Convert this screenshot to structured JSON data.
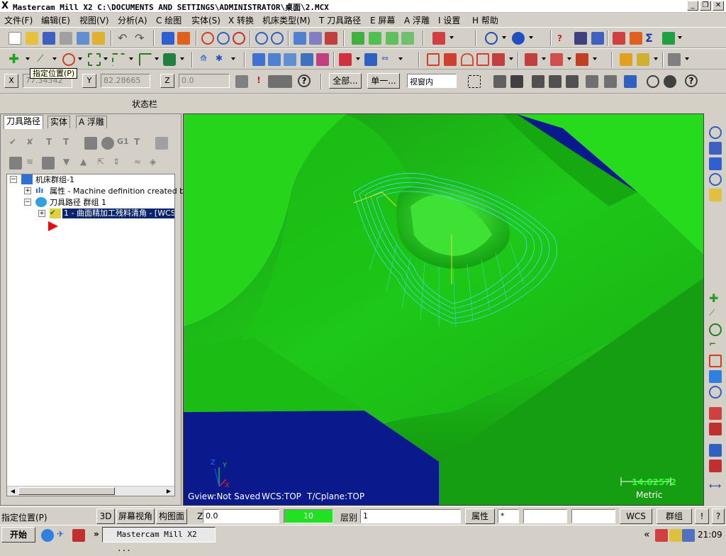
{
  "window": {
    "title": "Mastercam Mill  X2  C:\\DOCUMENTS AND SETTINGS\\ADMINISTRATOR\\桌面\\2.MCX",
    "icon": "mastercam-x-icon"
  },
  "menu": [
    "文件(F)",
    "编辑(E)",
    "视图(V)",
    "分析(A)",
    "C 绘图",
    "实体(S)",
    "X 转换",
    "机床类型(M)",
    "T 刀具路径",
    "E 屏幕",
    "A 浮雕",
    "I 设置",
    "H 帮助"
  ],
  "tooltip": "指定位置(P)",
  "autocursor": {
    "x_label": "X",
    "x_value": "77.34342",
    "y_label": "Y",
    "y_value": "82.28665",
    "z_label": "Z",
    "z_value": "0.0",
    "all_button": "全部...",
    "single_button": "单一...",
    "window_select": "视窗内"
  },
  "status_label": "状态栏",
  "left_panel": {
    "tabs": [
      "刀具路径",
      "实体",
      "A 浮雕"
    ],
    "tree": {
      "root": "机床群组-1",
      "properties": "属性 - Machine definition created by",
      "group": "刀具路径 群组 1",
      "operation": "1 - 曲面精加工残料清角 - [WCS"
    }
  },
  "viewport": {
    "gview": "Gview:Not Saved",
    "wcs": "WCS:TOP",
    "cplane": "T/Cplane:TOP",
    "scale_value": "14.82572",
    "scale_unit": "Metric",
    "axis_y": "Y",
    "axis_x": "X",
    "axis_z": "Z",
    "colors": {
      "background": "#0a1a8c",
      "part": "#22d21a",
      "toolpath": "#40e0e0"
    }
  },
  "statusbar": {
    "prompt": "指定位置(P)",
    "view_3d": "3D",
    "screen_view": "屏幕视角",
    "plane": "构图面",
    "z_label": "Z",
    "z_value": "0.0",
    "color_value": "10",
    "level_label": "层别",
    "level_value": "1",
    "attributes": "属性",
    "wcs": "WCS",
    "group": "群组",
    "excl": "!",
    "help": "?"
  },
  "taskbar": {
    "start": "开始",
    "task": "Mastercam Mill  X2 ...",
    "more": "«",
    "clock": "21:09"
  }
}
